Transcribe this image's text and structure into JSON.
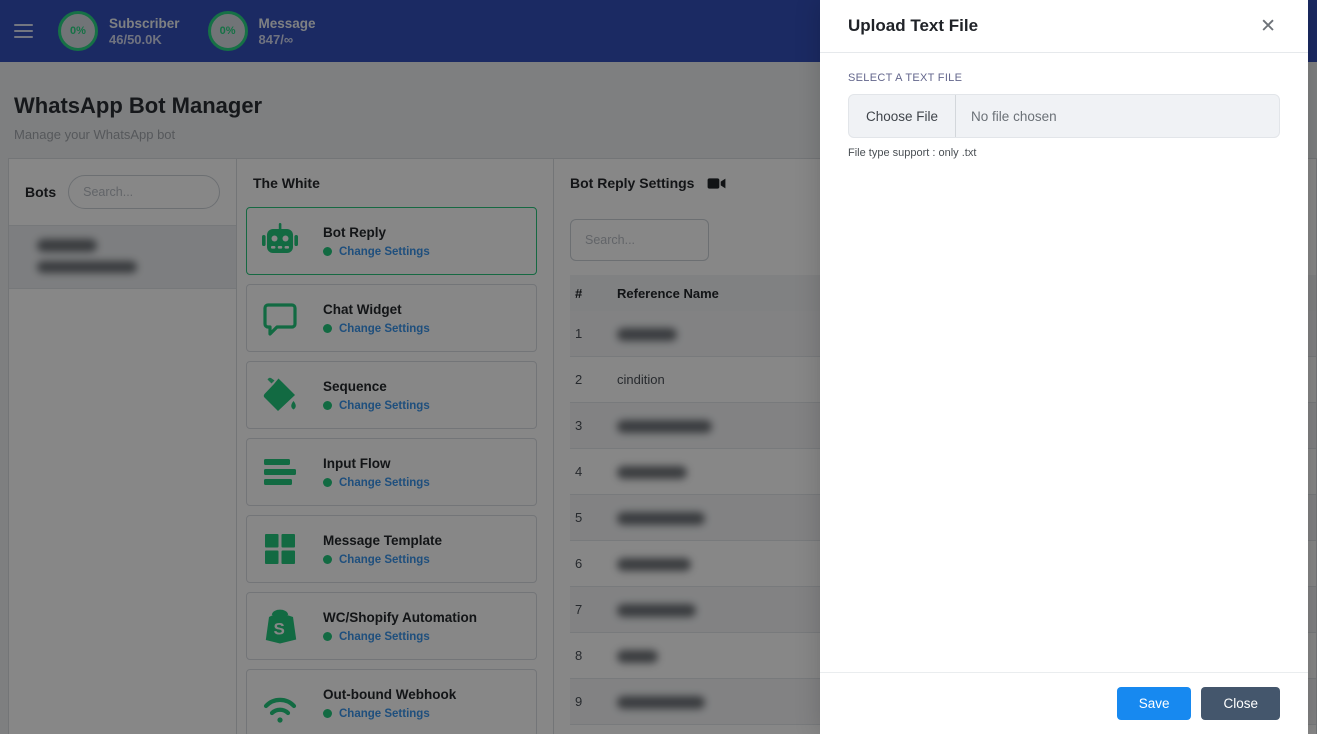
{
  "colors": {
    "navbar_bg": "#3350bc",
    "accent_green": "#22c87d",
    "link_blue": "#3b96ec",
    "save_blue": "#1789f0",
    "close_slate": "#44566c",
    "selected_border_green": "#2bc77e"
  },
  "navbar": {
    "stats": [
      {
        "percent": "0%",
        "label": "Subscriber",
        "value": "46/50.0K"
      },
      {
        "percent": "0%",
        "label": "Message",
        "value": "847/∞"
      }
    ]
  },
  "page": {
    "title": "WhatsApp Bot Manager",
    "subtitle": "Manage your WhatsApp bot"
  },
  "bots_panel": {
    "title": "Bots",
    "search_placeholder": "Search...",
    "items": [
      {
        "redacted": true,
        "name_width": 60,
        "phone_width": 100,
        "selected": true
      }
    ]
  },
  "bot_panel": {
    "title": "The White",
    "change_settings_label": "Change Settings",
    "cards": [
      {
        "label": "Bot Reply",
        "icon": "robot-icon",
        "selected": true
      },
      {
        "label": "Chat Widget",
        "icon": "chat-bubble-icon",
        "selected": false
      },
      {
        "label": "Sequence",
        "icon": "paint-bucket-icon",
        "selected": false
      },
      {
        "label": "Input Flow",
        "icon": "bars-icon",
        "selected": false
      },
      {
        "label": "Message Template",
        "icon": "grid-icon",
        "selected": false
      },
      {
        "label": "WC/Shopify Automation",
        "icon": "shopify-bag-icon",
        "selected": false
      },
      {
        "label": "Out-bound Webhook",
        "icon": "wifi-icon",
        "selected": false
      }
    ]
  },
  "settings_panel": {
    "title": "Bot Reply Settings",
    "video_icon": "video-camera-icon",
    "search_placeholder": "Search...",
    "table": {
      "columns": [
        "#",
        "Reference Name"
      ],
      "rows": [
        {
          "num": "1",
          "name": "",
          "redacted": true,
          "redacted_width": 60
        },
        {
          "num": "2",
          "name": "cindition",
          "redacted": false
        },
        {
          "num": "3",
          "name": "",
          "redacted": true,
          "redacted_width": 95
        },
        {
          "num": "4",
          "name": "",
          "redacted": true,
          "redacted_width": 70
        },
        {
          "num": "5",
          "name": "",
          "redacted": true,
          "redacted_width": 88
        },
        {
          "num": "6",
          "name": "",
          "redacted": true,
          "redacted_width": 74
        },
        {
          "num": "7",
          "name": "",
          "redacted": true,
          "redacted_width": 79
        },
        {
          "num": "8",
          "name": "",
          "redacted": true,
          "redacted_width": 41
        },
        {
          "num": "9",
          "name": "",
          "redacted": true,
          "redacted_width": 88
        }
      ]
    }
  },
  "modal": {
    "title": "Upload Text File",
    "close_icon": "✕",
    "file_field": {
      "label": "SELECT A TEXT FILE",
      "button_label": "Choose File",
      "status_text": "No file chosen",
      "helper_text": "File type support : only .txt"
    },
    "save_label": "Save",
    "close_label": "Close"
  }
}
